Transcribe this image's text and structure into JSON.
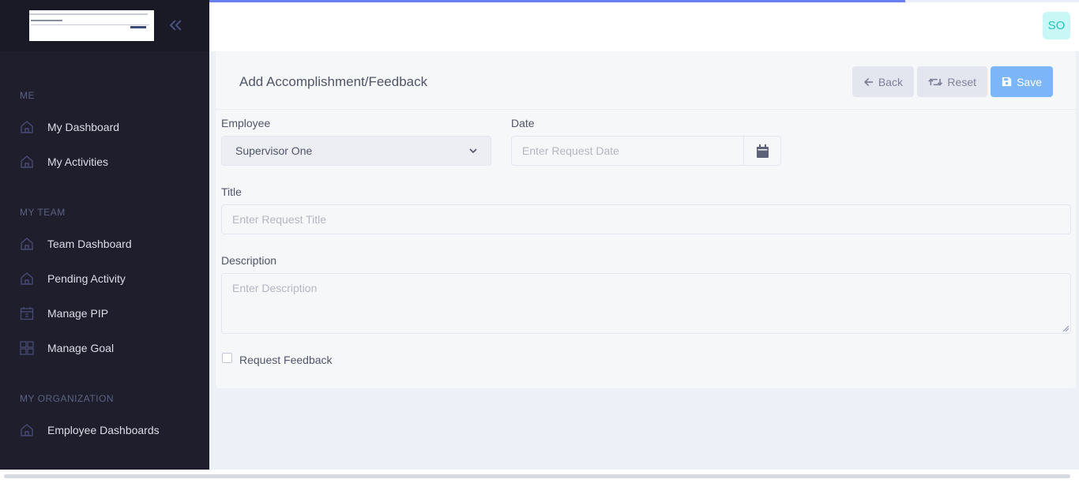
{
  "sidebar": {
    "sections": [
      {
        "title": "ME",
        "items": [
          {
            "label": "My Dashboard",
            "icon": "home-icon"
          },
          {
            "label": "My Activities",
            "icon": "home-icon"
          }
        ]
      },
      {
        "title": "MY TEAM",
        "items": [
          {
            "label": "Team Dashboard",
            "icon": "home-icon"
          },
          {
            "label": "Pending Activity",
            "icon": "home-icon"
          },
          {
            "label": "Manage PIP",
            "icon": "calendar-icon"
          },
          {
            "label": "Manage Goal",
            "icon": "grid-icon"
          }
        ]
      },
      {
        "title": "MY ORGANIZATION",
        "items": [
          {
            "label": "Employee Dashboards",
            "icon": "home-icon"
          }
        ]
      }
    ]
  },
  "header": {
    "avatar_initials": "SO",
    "progress": 0.8
  },
  "card": {
    "title": "Add Accomplishment/Feedback",
    "buttons": {
      "back": "Back",
      "reset": "Reset",
      "save": "Save"
    },
    "employee": {
      "label": "Employee",
      "value": "Supervisor One"
    },
    "date": {
      "label": "Date",
      "placeholder": "Enter Request Date"
    },
    "title_field": {
      "label": "Title",
      "placeholder": "Enter Request Title"
    },
    "description": {
      "label": "Description",
      "placeholder": "Enter Description"
    },
    "request_feedback": {
      "label": "Request Feedback",
      "checked": false
    }
  },
  "colors": {
    "sidebar": "#1e1e2d",
    "primary": "#7cb6f8",
    "avatar_bg": "#c9f7f5",
    "avatar_text": "#1bc5bd"
  }
}
